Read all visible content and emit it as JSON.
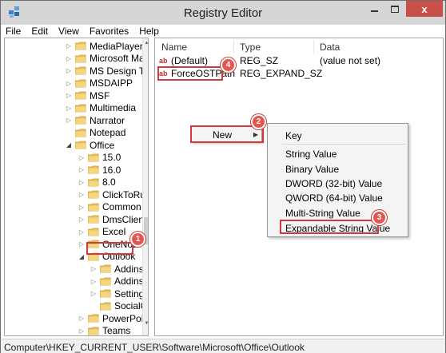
{
  "window": {
    "title": "Registry Editor",
    "close_symbol": "x"
  },
  "menu": [
    "File",
    "Edit",
    "View",
    "Favorites",
    "Help"
  ],
  "tree": {
    "items": [
      {
        "label": "MediaPlayer",
        "level": 1,
        "caret": "closed",
        "selected": false
      },
      {
        "label": "Microsoft Mar",
        "level": 1,
        "caret": "closed",
        "selected": false
      },
      {
        "label": "MS Design Too",
        "level": 1,
        "caret": "closed",
        "selected": false
      },
      {
        "label": "MSDAIPP",
        "level": 1,
        "caret": "closed",
        "selected": false
      },
      {
        "label": "MSF",
        "level": 1,
        "caret": "closed",
        "selected": false
      },
      {
        "label": "Multimedia",
        "level": 1,
        "caret": "closed",
        "selected": false
      },
      {
        "label": "Narrator",
        "level": 1,
        "caret": "closed",
        "selected": false
      },
      {
        "label": "Notepad",
        "level": 1,
        "caret": "none",
        "selected": false
      },
      {
        "label": "Office",
        "level": 1,
        "caret": "open",
        "selected": false
      },
      {
        "label": "15.0",
        "level": 2,
        "caret": "closed",
        "selected": false
      },
      {
        "label": "16.0",
        "level": 2,
        "caret": "closed",
        "selected": false
      },
      {
        "label": "8.0",
        "level": 2,
        "caret": "closed",
        "selected": false
      },
      {
        "label": "ClickToRur",
        "level": 2,
        "caret": "closed",
        "selected": false
      },
      {
        "label": "Common",
        "level": 2,
        "caret": "closed",
        "selected": false
      },
      {
        "label": "DmsClient",
        "level": 2,
        "caret": "closed",
        "selected": false
      },
      {
        "label": "Excel",
        "level": 2,
        "caret": "closed",
        "selected": false
      },
      {
        "label": "OneNot",
        "level": 2,
        "caret": "closed",
        "selected": false
      },
      {
        "label": "Outlook",
        "level": 2,
        "caret": "open",
        "selected": true
      },
      {
        "label": "Addins",
        "level": 3,
        "caret": "closed",
        "selected": false
      },
      {
        "label": "Addins",
        "level": 3,
        "caret": "closed",
        "selected": false
      },
      {
        "label": "Setting",
        "level": 3,
        "caret": "closed",
        "selected": false
      },
      {
        "label": "SocialC",
        "level": 3,
        "caret": "none",
        "selected": false
      },
      {
        "label": "PowerPoin",
        "level": 2,
        "caret": "closed",
        "selected": false
      },
      {
        "label": "Teams",
        "level": 2,
        "caret": "closed",
        "selected": false
      }
    ]
  },
  "list": {
    "columns": {
      "name": "Name",
      "type": "Type",
      "data": "Data"
    },
    "rows": [
      {
        "name": "(Default)",
        "type": "REG_SZ",
        "data": "(value not set)",
        "icon": "ab"
      },
      {
        "name": "ForceOSTPath",
        "type": "REG_EXPAND_SZ",
        "data": "",
        "icon": "ab"
      }
    ]
  },
  "context_menu": {
    "new_label": "New",
    "submenu": {
      "key": "Key",
      "string": "String Value",
      "binary": "Binary Value",
      "dword": "DWORD (32-bit) Value",
      "qword": "QWORD (64-bit) Value",
      "multi": "Multi-String Value",
      "expandable": "Expandable String Value"
    }
  },
  "callouts": [
    "1",
    "2",
    "3",
    "4"
  ],
  "status_path": "Computer\\HKEY_CURRENT_USER\\Software\\Microsoft\\Office\\Outlook",
  "colors": {
    "highlight_red": "#d3383b",
    "callout_fill": "#e4574f",
    "close_button": "#c7504b",
    "folder_yellow": "#e8c25a"
  },
  "icons": {
    "app": "registry-editor-icon",
    "folder": "folder-icon",
    "string_value": "ab-string-value-icon"
  }
}
